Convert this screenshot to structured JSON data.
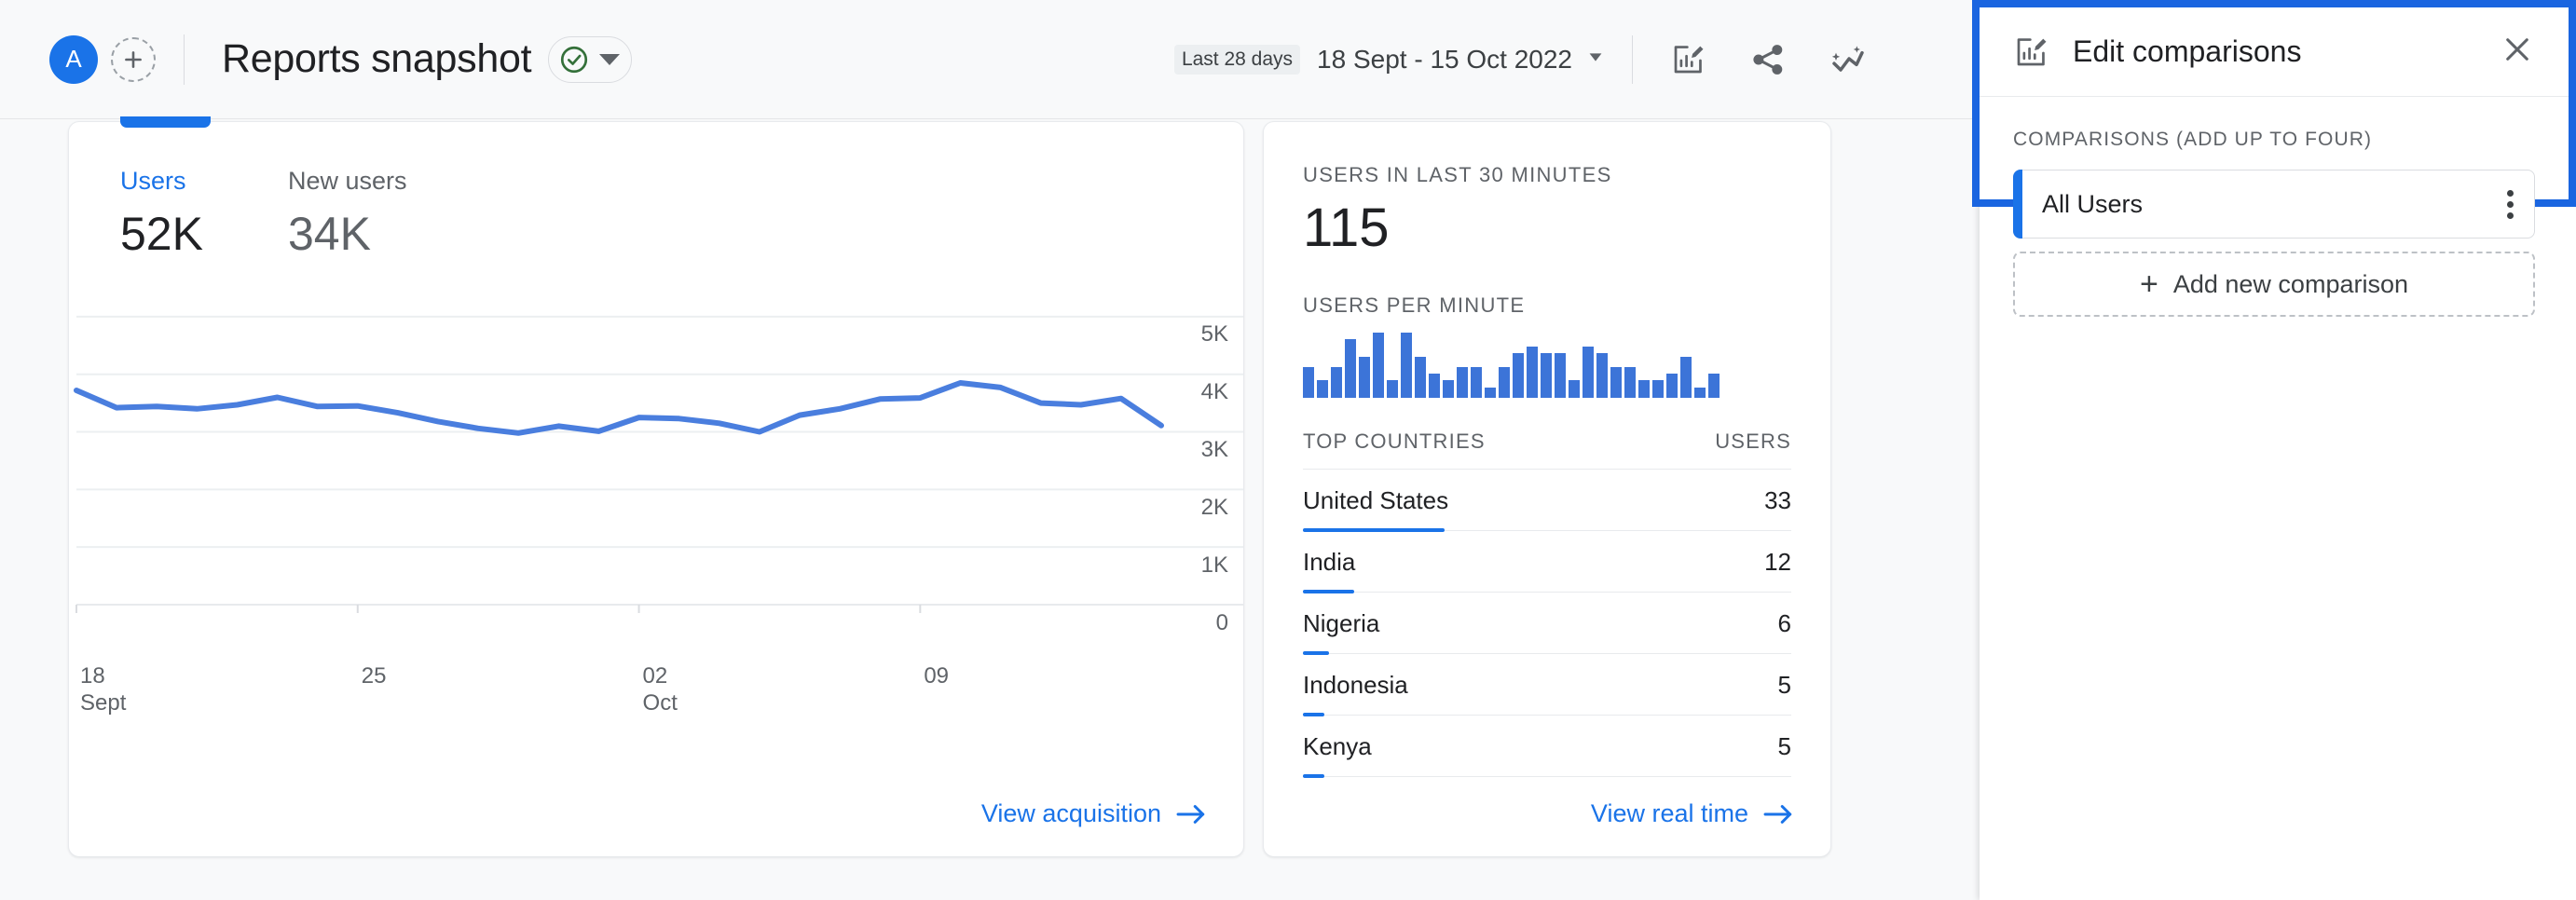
{
  "header": {
    "avatar_initial": "A",
    "add_account_icon": "plus-circle-icon",
    "title": "Reports snapshot",
    "status_icon": "check-circle-icon",
    "status_caret_icon": "chevron-down-icon",
    "date_range_chip": "Last 28 days",
    "date_range_text": "18 Sept - 15 Oct 2022",
    "date_caret_icon": "chevron-down-icon",
    "edit_comparisons_icon": "chart-edit-icon",
    "share_icon": "share-icon",
    "insights_icon": "insights-icon"
  },
  "users_card": {
    "metrics": [
      {
        "label": "Users",
        "value": "52K",
        "active": true
      },
      {
        "label": "New users",
        "value": "34K",
        "active": false
      }
    ],
    "link_label": "View acquisition",
    "link_arrow_icon": "arrow-right-icon"
  },
  "chart_data": {
    "type": "line",
    "title": "Users",
    "xlabel": "",
    "ylabel": "",
    "ylim": [
      0,
      5500
    ],
    "grid": true,
    "legend": "none",
    "line_color": "#4a7ede",
    "y_ticks": [
      "5K",
      "4K",
      "3K",
      "2K",
      "1K",
      "0"
    ],
    "y_tick_values": [
      5000,
      4000,
      3000,
      2000,
      1000,
      0
    ],
    "x_ticks": [
      {
        "label": "18",
        "sublabel": "Sept",
        "index": 0
      },
      {
        "label": "25",
        "sublabel": "",
        "index": 7
      },
      {
        "label": "02",
        "sublabel": "Oct",
        "index": 14
      },
      {
        "label": "09",
        "sublabel": "",
        "index": 21
      }
    ],
    "categories": [
      "18 Sept",
      "19 Sept",
      "20 Sept",
      "21 Sept",
      "22 Sept",
      "23 Sept",
      "24 Sept",
      "25 Sept",
      "26 Sept",
      "27 Sept",
      "28 Sept",
      "29 Sept",
      "30 Sept",
      "01 Oct",
      "02 Oct",
      "03 Oct",
      "04 Oct",
      "05 Oct",
      "06 Oct",
      "07 Oct",
      "08 Oct",
      "09 Oct",
      "10 Oct",
      "11 Oct",
      "12 Oct",
      "13 Oct",
      "14 Oct",
      "15 Oct"
    ],
    "values": [
      3720,
      3420,
      3440,
      3400,
      3470,
      3600,
      3440,
      3450,
      3330,
      3180,
      3060,
      2980,
      3100,
      3010,
      3250,
      3230,
      3150,
      3000,
      3290,
      3400,
      3570,
      3590,
      3850,
      3770,
      3500,
      3470,
      3580,
      3110
    ]
  },
  "realtime_card": {
    "users_caption": "USERS IN LAST 30 MINUTES",
    "users_value": "115",
    "per_minute_caption": "USERS PER MINUTE",
    "per_minute_values": [
      9,
      5,
      9,
      17,
      12,
      19,
      5,
      19,
      12,
      7,
      5,
      9,
      9,
      3,
      9,
      13,
      15,
      13,
      13,
      5,
      15,
      13,
      9,
      9,
      5,
      5,
      7,
      12,
      3,
      7
    ],
    "table": {
      "columns": [
        "TOP COUNTRIES",
        "USERS"
      ],
      "rows": [
        {
          "name": "United States",
          "users": "33",
          "pct": 29
        },
        {
          "name": "India",
          "users": "12",
          "pct": 10.5
        },
        {
          "name": "Nigeria",
          "users": "6",
          "pct": 5.3
        },
        {
          "name": "Indonesia",
          "users": "5",
          "pct": 4.4
        },
        {
          "name": "Kenya",
          "users": "5",
          "pct": 4.4
        }
      ]
    },
    "link_label": "View real time",
    "link_arrow_icon": "arrow-right-icon"
  },
  "side_panel": {
    "icon": "chart-edit-icon",
    "title": "Edit comparisons",
    "close_icon": "close-icon",
    "section_caption": "COMPARISONS (ADD UP TO FOUR)",
    "comparisons": [
      {
        "label": "All Users",
        "menu_icon": "more-vert-icon"
      }
    ],
    "add_label": "Add new comparison",
    "add_icon": "plus-icon"
  },
  "colors": {
    "accent_blue": "#1a73e8",
    "line_blue": "#4a7ede",
    "bar_blue": "#3c74d8",
    "highlight_border": "#1a65e0",
    "text_primary": "#202124",
    "text_secondary": "#5f6368",
    "page_bg": "#f8f9fa"
  }
}
